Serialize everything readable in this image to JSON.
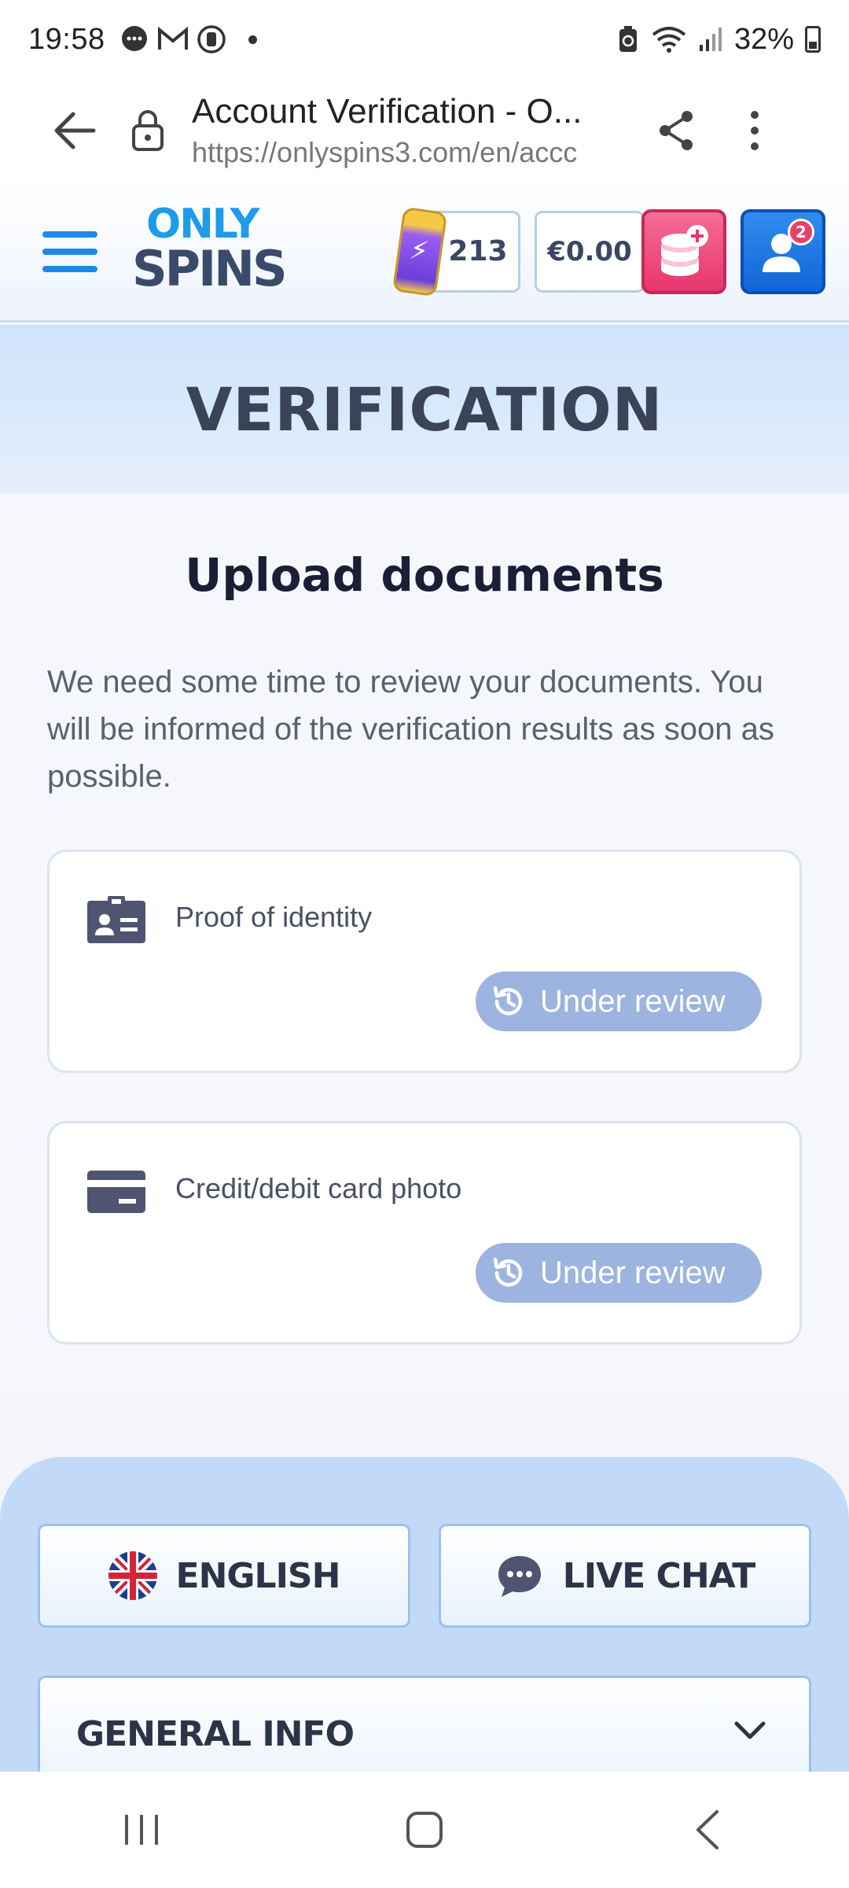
{
  "status_bar": {
    "time": "19:58",
    "battery_pct": "32%",
    "icons": [
      "chat-bubble-icon",
      "gmail-icon",
      "app-icon",
      "notification-dot-icon",
      "battery-saver-icon",
      "wifi-icon",
      "signal-icon",
      "battery-icon"
    ]
  },
  "browser": {
    "title": "Account Verification - O...",
    "url": "https://onlyspins3.com/en/accc",
    "icons": [
      "back-arrow-icon",
      "lock-icon",
      "share-icon",
      "more-vert-icon"
    ]
  },
  "header": {
    "logo_top": "ONLY",
    "logo_bottom": "SPINS",
    "points": "213",
    "balance": "€0.00",
    "notification_count": "2",
    "colors": {
      "accent_blue": "#1e88e5",
      "deposit_pink": "#e9356e",
      "profile_blue": "#1265d6"
    }
  },
  "banner": {
    "title": "VERIFICATION"
  },
  "content": {
    "title": "Upload documents",
    "description": "We need some time to review your documents. You will be informed of the verification results as soon as possible.",
    "documents": [
      {
        "label": "Proof of identity",
        "icon": "id-card-icon",
        "status": "Under review"
      },
      {
        "label": "Credit/debit card photo",
        "icon": "credit-card-icon",
        "status": "Under review"
      }
    ],
    "status_color": "#9db3e0"
  },
  "footer": {
    "language_label": "ENGLISH",
    "chat_label": "LIVE CHAT",
    "general_info_label": "GENERAL INFO"
  },
  "nav": {
    "icons": [
      "recent-apps-icon",
      "home-icon",
      "back-icon"
    ]
  }
}
